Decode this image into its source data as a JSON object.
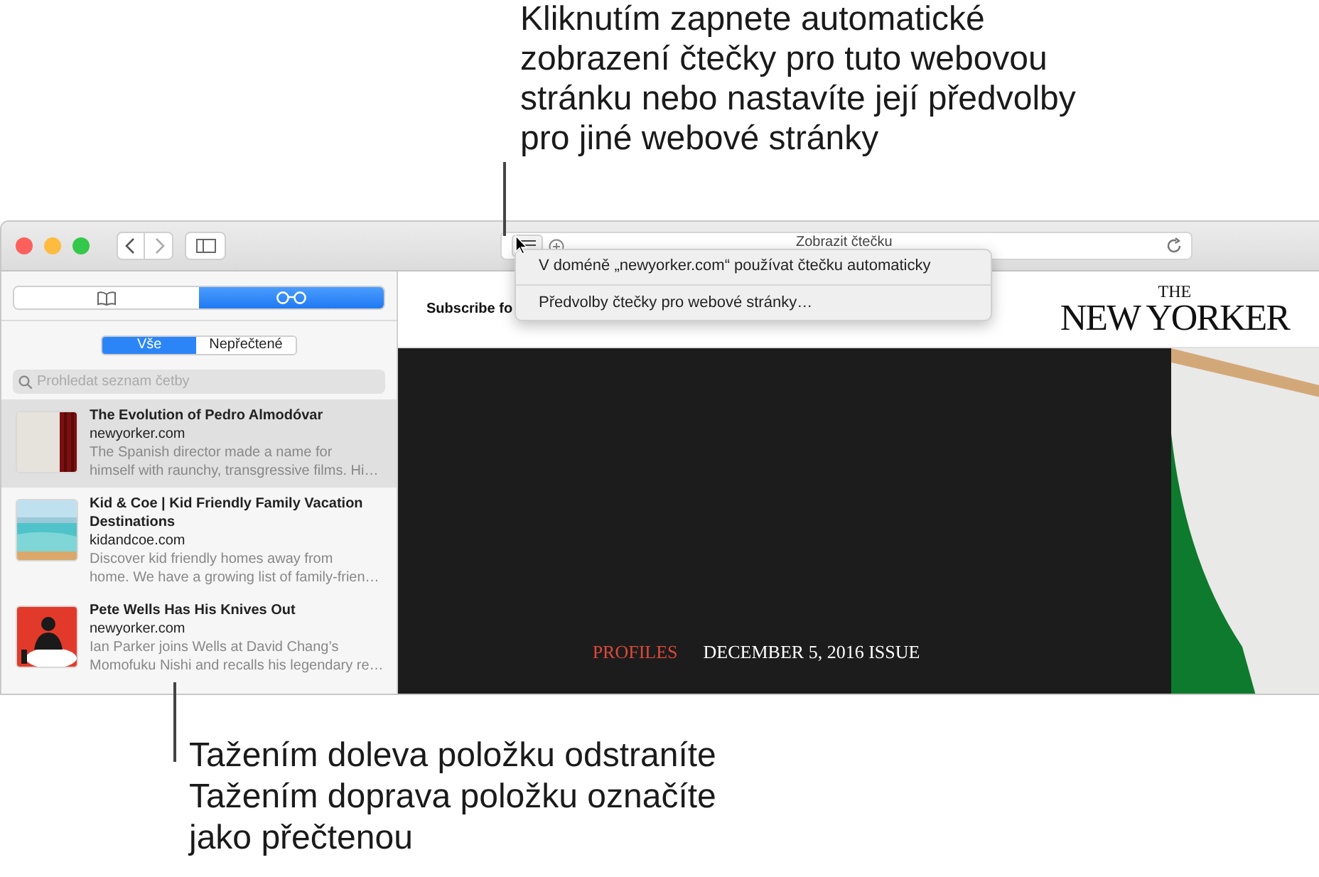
{
  "callout_top": {
    "lines": [
      "Kliknutím zapnete automatické",
      "zobrazení čtečky pro tuto webovou",
      "stránku nebo nastavíte její předvolby",
      "pro jiné webové stránky"
    ]
  },
  "toolbar": {
    "address_text": "Zobrazit čtečku"
  },
  "reader_menu": {
    "items": [
      "V doméně „newyorker.com“ používat čtečku automaticky",
      "Předvolby čtečky pro webové stránky…"
    ]
  },
  "sidebar": {
    "tabs": [
      {
        "kind": "bookmarks",
        "selected": false
      },
      {
        "kind": "reading_list",
        "selected": true
      }
    ],
    "filters": [
      {
        "label": "Vše",
        "selected": true
      },
      {
        "label": "Nepřečtené",
        "selected": false
      }
    ],
    "search": {
      "placeholder": "Prohledat seznam četby"
    },
    "items": [
      {
        "title": "The Evolution of Pedro Almodóvar",
        "domain": "newyorker.com",
        "excerpt_lines": [
          "The Spanish director made a name for",
          "himself with raunchy, transgressive films. Hi…"
        ],
        "selected": true
      },
      {
        "title": "Kid & Coe | Kid Friendly Family Vacation Destinations",
        "domain": "kidandcoe.com",
        "excerpt_lines": [
          "Discover kid friendly homes away from",
          "home. We have a growing list of family-frien…"
        ],
        "selected": false
      },
      {
        "title": "Pete Wells Has His Knives Out",
        "domain": "newyorker.com",
        "excerpt_lines": [
          "Ian Parker joins Wells at David Chang’s",
          "Momofuku Nishi and recalls his legendary re…"
        ],
        "selected": false
      }
    ]
  },
  "page": {
    "subscribe": "Subscribe fo",
    "logo_top": "THE",
    "logo": "NEW YORKER",
    "section": "PROFILES",
    "issue": "DECEMBER 5, 2016 ISSUE"
  },
  "callout_bottom": {
    "lines": [
      "Tažením doleva položku odstraníte",
      "Tažením doprava položku označíte",
      "jako přečtenou"
    ]
  }
}
